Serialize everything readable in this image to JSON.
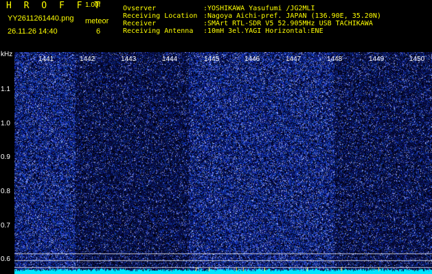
{
  "header": {
    "brand": "H R O F F T",
    "version": "1.00f",
    "filename": "YY2611261440.png",
    "datetime": "26.11.26 14:40",
    "meteor_label": "meteor",
    "meteor_count": "6",
    "info": [
      {
        "label": "Ovserver",
        "value": ":YOSHIKAWA Yasufumi /JG2MLI"
      },
      {
        "label": "Receiving Location",
        "value": ":Nagoya Aichi-pref. JAPAN (136.90E, 35.20N)"
      },
      {
        "label": "Receiver",
        "value": ":SMArt RTL-SDR V5 52.905MHz USB TACHIKAWA"
      },
      {
        "label": "Receiving Antenna",
        "value": ":10mH 3el.YAGI Horizontal:ENE"
      }
    ]
  },
  "spectrogram": {
    "y_unit": "kHz",
    "y_ticks": [
      "1.1",
      "1.0",
      "0.9",
      "0.8",
      "0.7",
      "0.6"
    ],
    "x_ticks": [
      "1441",
      "1442",
      "1443",
      "1444",
      "1445",
      "1446",
      "1447",
      "1448",
      "1449",
      "1450"
    ],
    "colors": {
      "background": "#000000",
      "signal": "#1a2a9a",
      "noise_high": "#ffffff",
      "trace": "#00e5ff",
      "text": "#ffff00"
    }
  }
}
